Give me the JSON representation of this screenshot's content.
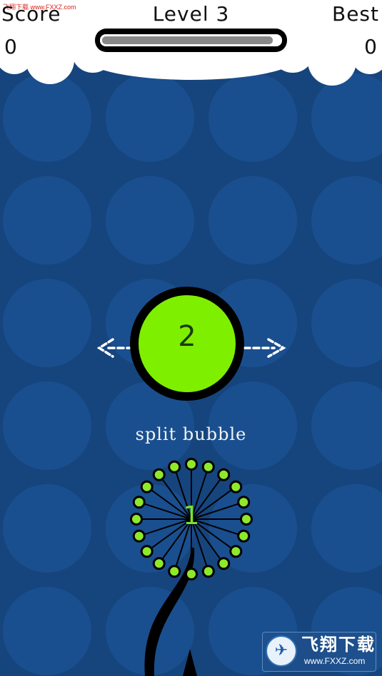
{
  "hud": {
    "score_label": "Score",
    "score_value": "0",
    "level_label": "Level 3",
    "best_label": "Best",
    "best_value": "0",
    "progress": 0.96
  },
  "tutorial": {
    "bubble_number": "2",
    "caption": "split bubble",
    "cluster_number": "1"
  },
  "watermark": {
    "top_text": "飞翔下载 www.FXXZ.com",
    "logo_cn": "飞翔下载",
    "logo_url": "www.FXXZ.com"
  },
  "colors": {
    "background": "#16457e",
    "bg_circle": "#1a4f8f",
    "cloud": "#ffffff",
    "bubble_fill": "#7fef00",
    "bubble_border": "#000000",
    "dot_fill": "#8fe82a",
    "stem": "#000000",
    "arrow": "#ffffff",
    "progress_bar": "#888888"
  },
  "icons": {
    "left_arrow": "dashed-left-arrow-icon",
    "right_arrow": "dashed-right-arrow-icon",
    "logo": "fxxz-logo-icon"
  }
}
